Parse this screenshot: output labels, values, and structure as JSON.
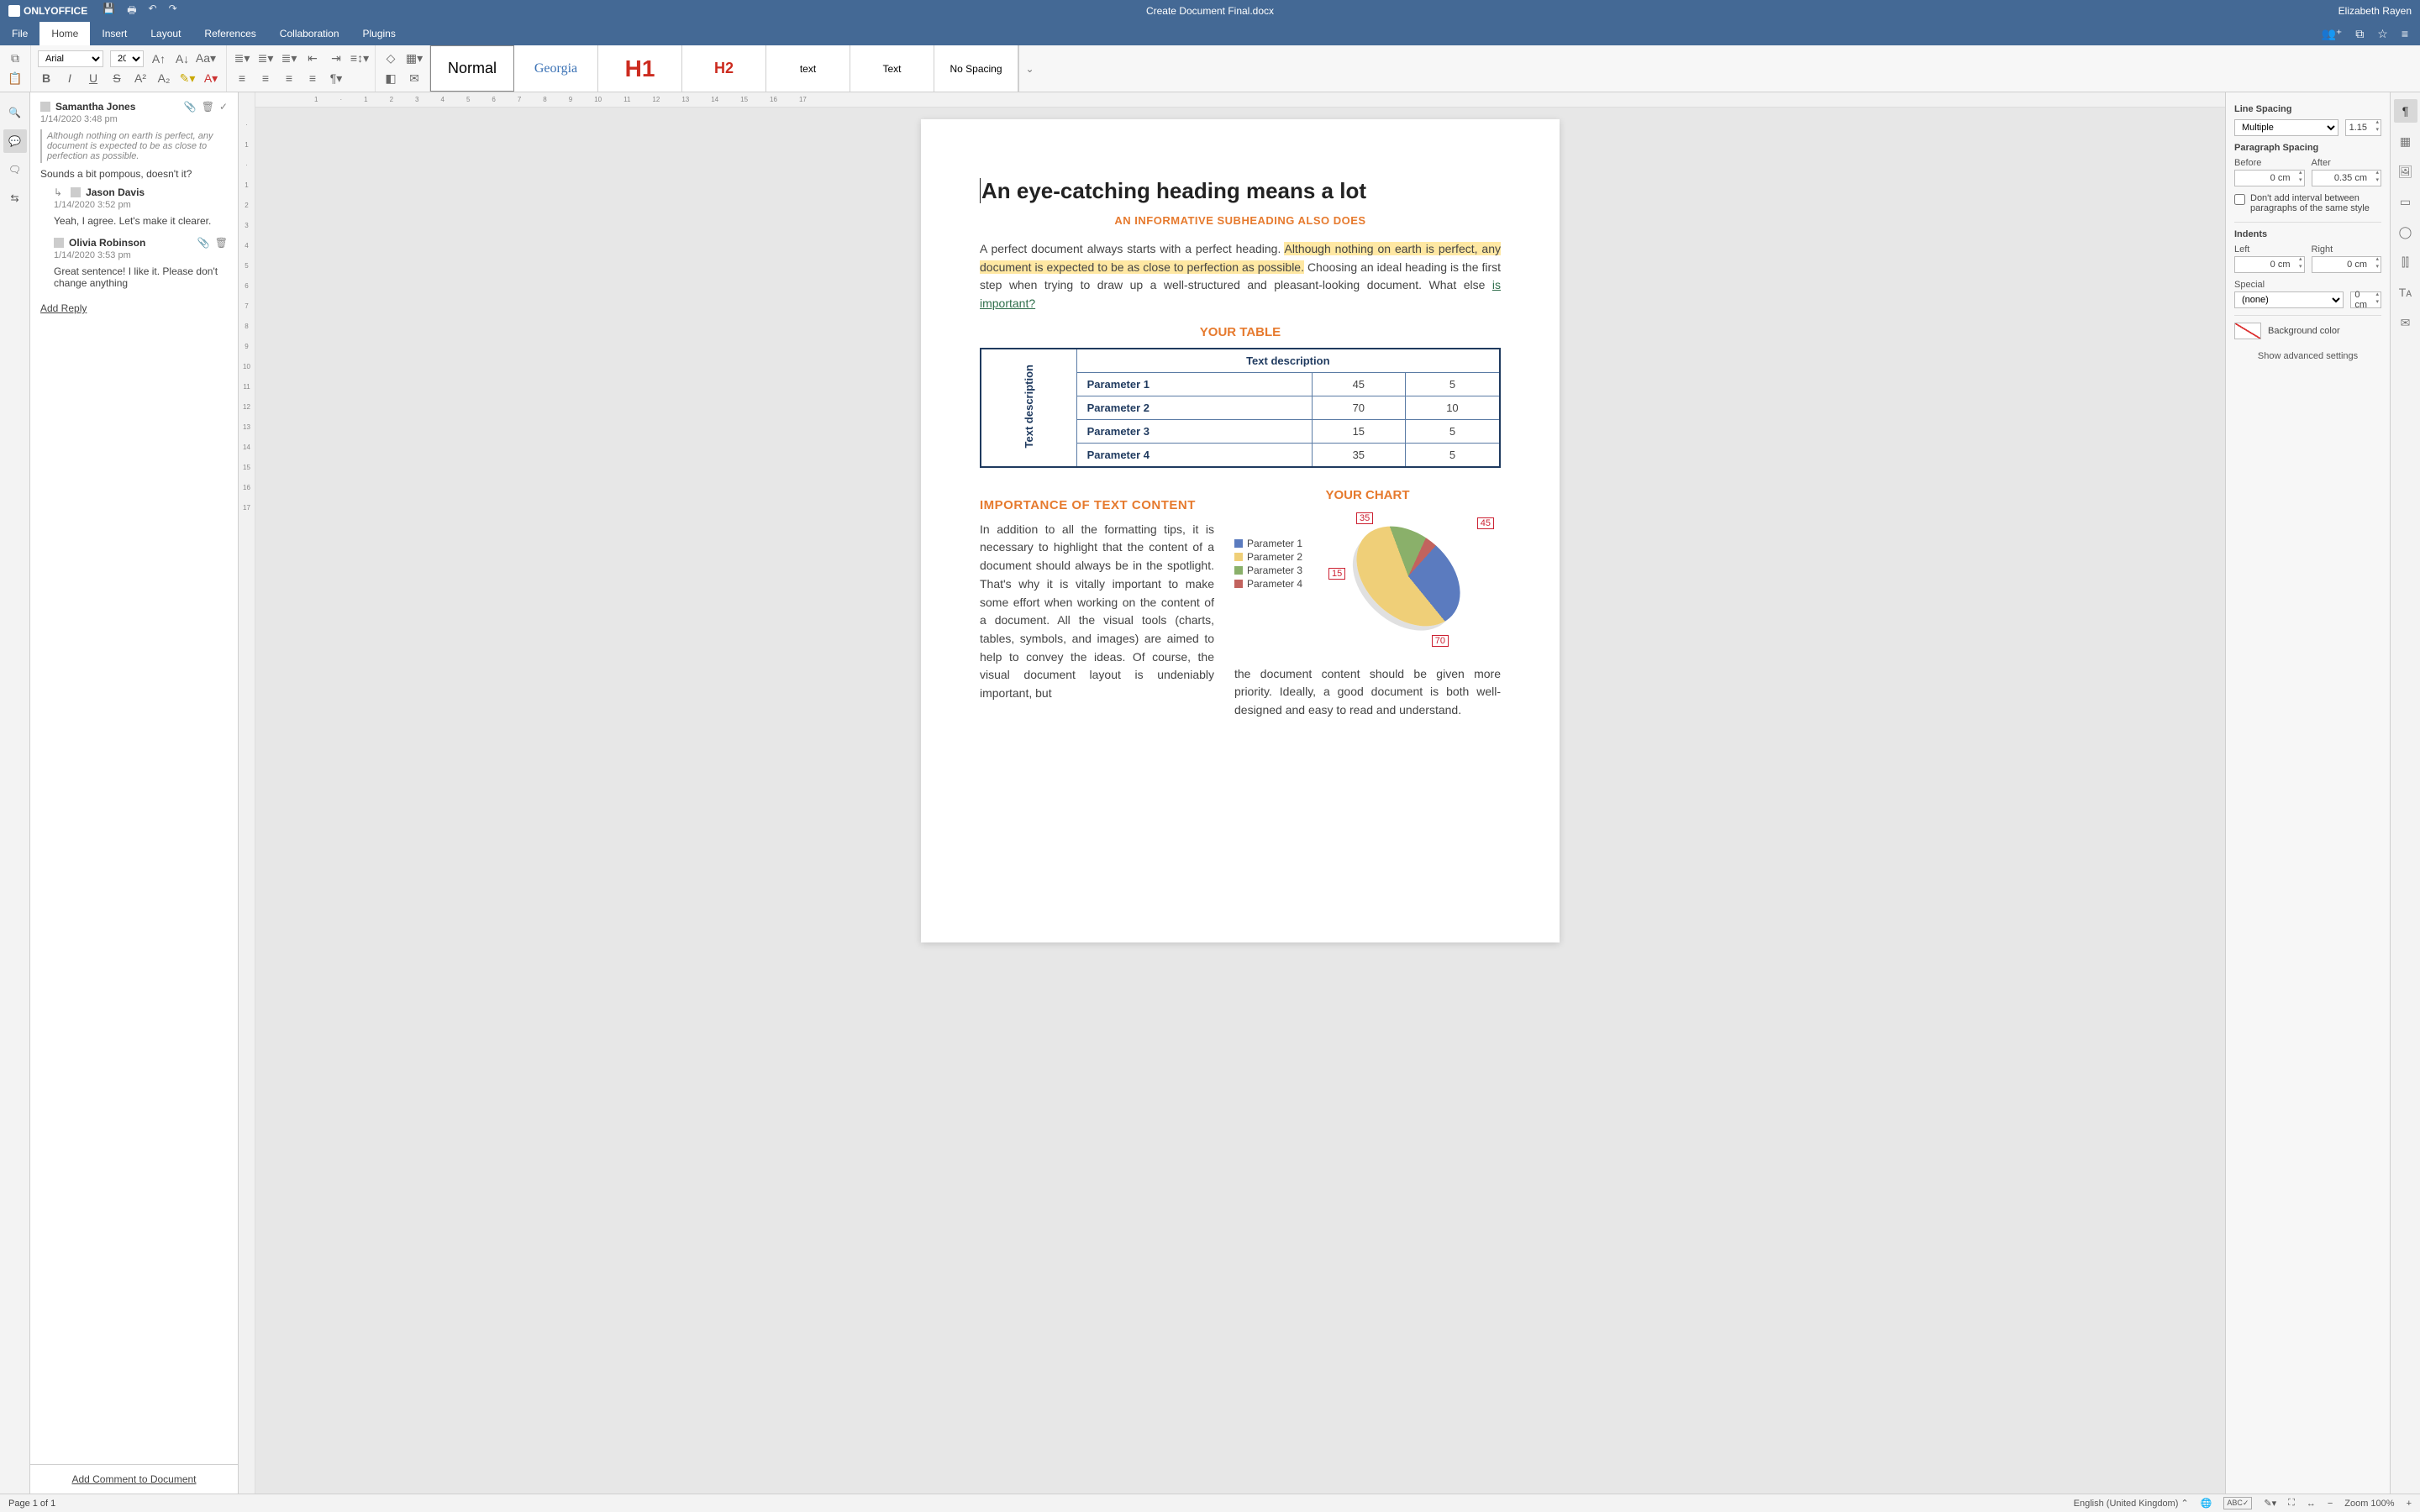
{
  "app": {
    "name": "ONLYOFFICE",
    "doc_title": "Create Document Final.docx",
    "user": "Elizabeth Rayen"
  },
  "menu_tabs": [
    "File",
    "Home",
    "Insert",
    "Layout",
    "References",
    "Collaboration",
    "Plugins"
  ],
  "menu_active_index": 1,
  "ribbon": {
    "font_name": "Arial",
    "font_size": "20",
    "styles": [
      {
        "label": "Normal",
        "kind": "normal"
      },
      {
        "label": "Georgia",
        "kind": "georgia"
      },
      {
        "label": "H1",
        "kind": "h1"
      },
      {
        "label": "H2",
        "kind": "h2"
      },
      {
        "label": "text",
        "kind": "text"
      },
      {
        "label": "Text",
        "kind": "text2"
      },
      {
        "label": "No Spacing",
        "kind": "nospacing"
      }
    ],
    "selected_style_index": 0
  },
  "comments": {
    "panel_footer": "Add Comment to Document",
    "add_reply_label": "Add Reply",
    "thread": {
      "author": "Samantha Jones",
      "date": "1/14/2020 3:48 pm",
      "quote": "Although nothing on earth is perfect, any document is expected to be as close to perfection as possible.",
      "text": "Sounds a bit pompous, doesn't it?",
      "replies": [
        {
          "author": "Jason Davis",
          "date": "1/14/2020 3:52 pm",
          "text": "Yeah, I agree. Let's make it clearer."
        },
        {
          "author": "Olivia Robinson",
          "date": "1/14/2020 3:53 pm",
          "text": "Great sentence! I like it. Please don't change anything"
        }
      ]
    }
  },
  "document": {
    "heading": "An eye-catching heading means a lot",
    "subheading": "AN INFORMATIVE SUBHEADING ALSO DOES",
    "para1_pre": "A perfect document always starts with a perfect heading. ",
    "para1_hl": "Although nothing on earth is perfect, any document is expected to be as close to perfection as possible.",
    "para1_post": " Choosing an ideal heading is the first step when trying to draw up a well-structured and pleasant-looking document. What else  ",
    "para1_link": "is important?",
    "table_title": "YOUR TABLE",
    "table_col_header": "Text description",
    "table_row_header": "Text description",
    "table": [
      {
        "param": "Parameter 1",
        "v1": "45",
        "v2": "5"
      },
      {
        "param": "Parameter 2",
        "v1": "70",
        "v2": "10"
      },
      {
        "param": "Parameter 3",
        "v1": "15",
        "v2": "5"
      },
      {
        "param": "Parameter 4",
        "v1": "35",
        "v2": "5"
      }
    ],
    "importance_title": "IMPORTANCE OF TEXT CONTENT",
    "importance_para": "In addition to all the formatting tips, it is necessary to highlight that the content of a document should always be in the spotlight. That's why it is vitally important to make some effort when working on the content of a document. All the visual tools (charts, tables, symbols, and images) are aimed to help to convey the ideas. Of course, the visual document layout is undeniably important, but",
    "importance_para_cont": "the document content should be given more priority. Ideally, a good document is both well-designed and easy to read and understand.",
    "chart_title": "YOUR CHART"
  },
  "chart_data": {
    "type": "pie",
    "title": "YOUR CHART",
    "series": [
      {
        "name": "Parameter 1",
        "value": 35,
        "color": "#5b7bbf"
      },
      {
        "name": "Parameter 2",
        "value": 70,
        "color": "#efcf78"
      },
      {
        "name": "Parameter 3",
        "value": 15,
        "color": "#8ab06a"
      },
      {
        "name": "Parameter 4",
        "value": 5,
        "color": "#c2635e"
      }
    ],
    "callouts": [
      "35",
      "45",
      "15",
      "70"
    ]
  },
  "format_panel": {
    "line_spacing_title": "Line Spacing",
    "line_spacing_mode": "Multiple",
    "line_spacing_value": "1.15",
    "para_spacing_title": "Paragraph Spacing",
    "before_label": "Before",
    "after_label": "After",
    "before_value": "0 cm",
    "after_value": "0.35 cm",
    "no_interval_label": "Don't add interval between paragraphs of the same style",
    "indents_title": "Indents",
    "left_label": "Left",
    "right_label": "Right",
    "left_value": "0 cm",
    "right_value": "0 cm",
    "special_label": "Special",
    "special_mode": "(none)",
    "special_value": "0 cm",
    "bg_label": "Background color",
    "advanced_link": "Show advanced settings"
  },
  "statusbar": {
    "page_info": "Page 1 of 1",
    "language": "English (United Kingdom)",
    "zoom": "Zoom 100%"
  }
}
